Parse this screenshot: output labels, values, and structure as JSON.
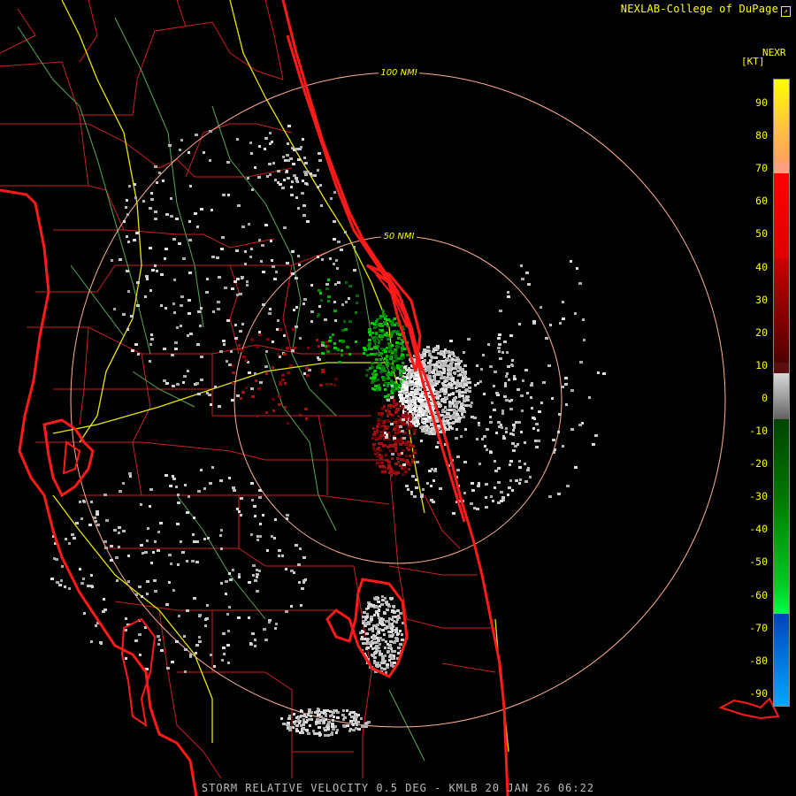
{
  "header": {
    "source": "NEXLAB-College of DuPage",
    "logo_icon": "nexlab-logo-icon"
  },
  "map": {
    "range_rings": [
      {
        "label": "100 NMI",
        "radius_nmi": 100
      },
      {
        "label": "50 NMI",
        "radius_nmi": 50
      }
    ],
    "colors": {
      "boundaries": "#ff2020",
      "roads": "#ffff33",
      "rivers": "#66cc66",
      "rings": "#ffb090",
      "coast": "#ff1a1a"
    }
  },
  "legend": {
    "title": "NEXR",
    "unit": "[KT]",
    "ticks": [
      "90",
      "80",
      "70",
      "60",
      "50",
      "40",
      "30",
      "20",
      "10",
      "0",
      "-10",
      "-20",
      "-30",
      "-40",
      "-50",
      "-60",
      "-70",
      "-80",
      "-90"
    ],
    "range": [
      -95,
      95
    ],
    "colors": {
      "high": "#ffff00",
      "outbound": "#ff0000",
      "near_zero": "#aaaaaa",
      "inbound": "#00cc00",
      "low": "#0088ff"
    }
  },
  "footer": {
    "product": "STORM RELATIVE VELOCITY 0.5 DEG - KMLB 20 JAN 26 06:22"
  }
}
